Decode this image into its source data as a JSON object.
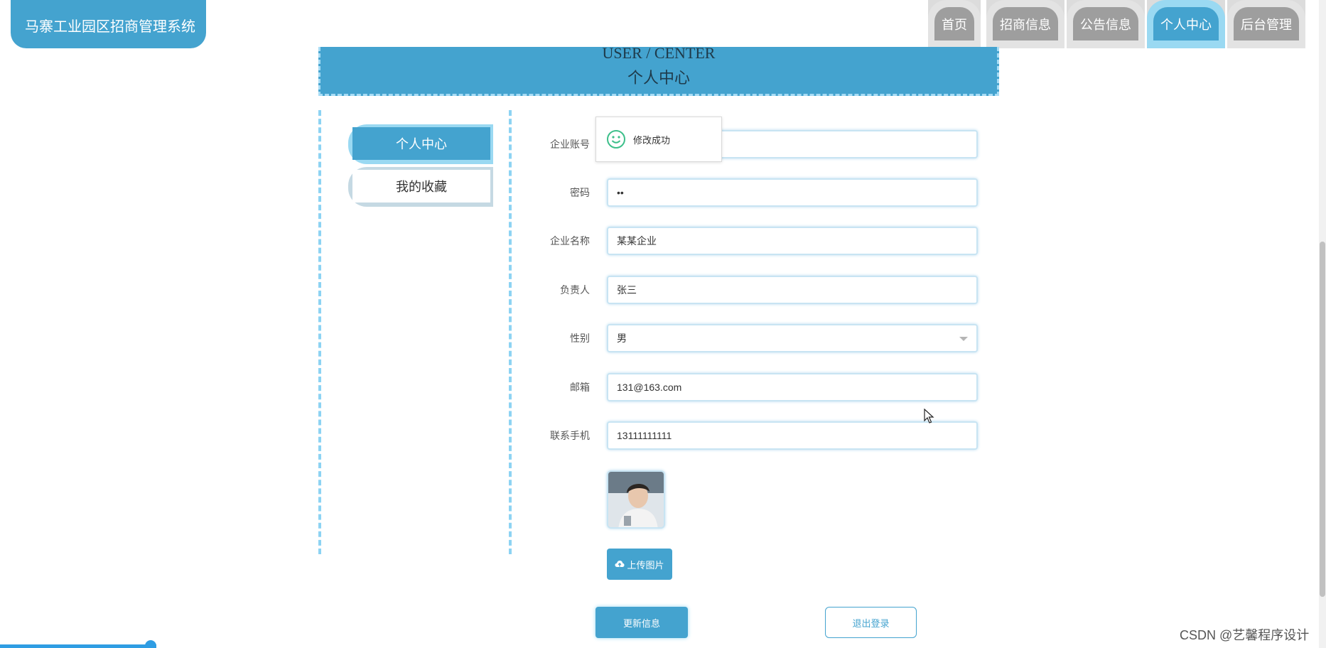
{
  "app": {
    "title": "马寨工业园区招商管理系统"
  },
  "nav": {
    "items": [
      {
        "label": "首页",
        "active": false
      },
      {
        "label": "招商信息",
        "active": false
      },
      {
        "label": "公告信息",
        "active": false
      },
      {
        "label": "个人中心",
        "active": true
      },
      {
        "label": "后台管理",
        "active": false
      }
    ]
  },
  "banner": {
    "en": "USER / CENTER",
    "cn": "个人中心"
  },
  "side": {
    "items": [
      {
        "label": "个人中心",
        "active": true
      },
      {
        "label": "我的收藏",
        "active": false
      }
    ]
  },
  "form": {
    "account_label": "企业账号",
    "account_value": "",
    "password_label": "密码",
    "password_value": "••",
    "company_label": "企业名称",
    "company_value": "某某企业",
    "person_label": "负责人",
    "person_value": "张三",
    "gender_label": "性别",
    "gender_value": "男",
    "email_label": "邮箱",
    "email_value": "131@163.com",
    "phone_label": "联系手机",
    "phone_value": "13111111111"
  },
  "buttons": {
    "upload": "上传图片",
    "update": "更新信息",
    "logout": "退出登录"
  },
  "toast": {
    "message": "修改成功"
  },
  "watermark": "CSDN @艺馨程序设计",
  "colors": {
    "primary": "#44a3cf",
    "accent_light": "#9ad9f2",
    "nav_gray": "#9e9e9e"
  }
}
